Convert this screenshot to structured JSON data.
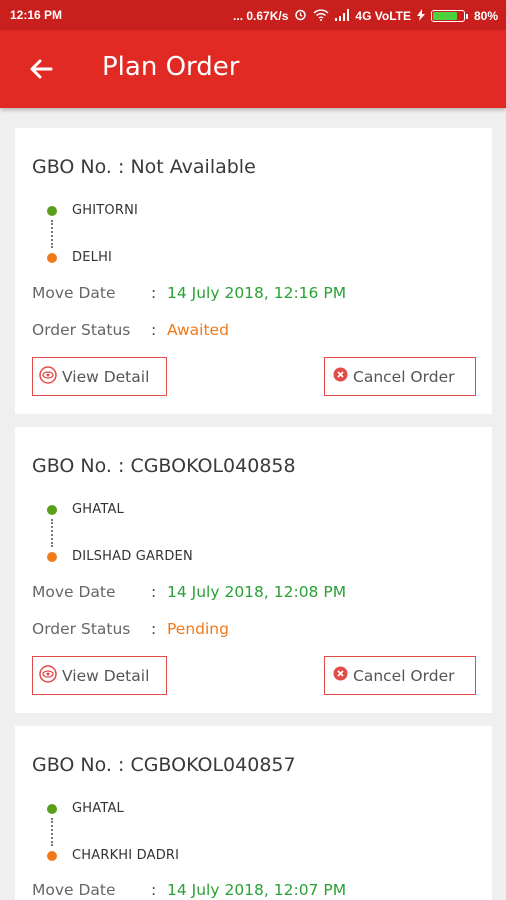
{
  "status_bar": {
    "time": "12:16 PM",
    "network_speed": "... 0.67K/s",
    "network": "4G VoLTE",
    "battery": "80%",
    "battery_level": 0.8
  },
  "app_bar": {
    "title": "Plan Order",
    "back_icon": "arrow-left-icon"
  },
  "orders": [
    {
      "gbo": "GBO No. : Not Available",
      "from": "GHITORNI",
      "to": "DELHI",
      "move_date_label": "Move Date",
      "move_date": "14 July 2018, 12:16 PM",
      "status_label": "Order Status",
      "status": "Awaited",
      "view_label": "View Detail",
      "cancel_label": "Cancel Order"
    },
    {
      "gbo": "GBO No. : CGBOKOL040858",
      "from": "GHATAL",
      "to": "DILSHAD GARDEN",
      "move_date_label": "Move Date",
      "move_date": "14 July 2018, 12:08 PM",
      "status_label": "Order Status",
      "status": "Pending",
      "view_label": "View Detail",
      "cancel_label": "Cancel Order"
    },
    {
      "gbo": "GBO No. : CGBOKOL040857",
      "from": "GHATAL",
      "to": "CHARKHI DADRI",
      "move_date_label": "Move Date",
      "move_date": "14 July 2018, 12:07 PM"
    }
  ],
  "colors": {
    "primary": "#e12a24",
    "status_bar": "#c9201d",
    "date": "#2aa135",
    "status": "#f07a1a"
  }
}
